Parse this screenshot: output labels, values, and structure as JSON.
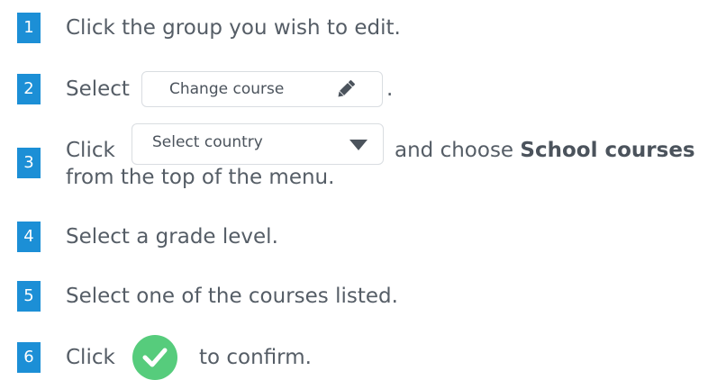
{
  "steps": [
    {
      "number": "1",
      "text": "Click the group you wish to edit."
    },
    {
      "number": "2",
      "prefix": "Select",
      "button_label": "Change course",
      "button_icon": "pencil-icon",
      "suffix": "."
    },
    {
      "number": "3",
      "prefix": "Click",
      "dropdown_label": "Select country",
      "dropdown_icon": "caret-down-icon",
      "middle": "and choose",
      "bold": "School courses",
      "line2": "from the top of the menu."
    },
    {
      "number": "4",
      "text": "Select a grade level."
    },
    {
      "number": "5",
      "text": "Select one of the courses listed."
    },
    {
      "number": "6",
      "prefix": "Click",
      "button_icon": "checkmark-icon",
      "suffix": "to confirm."
    }
  ],
  "colors": {
    "badge": "#1c8fd6",
    "text": "#555d66",
    "confirm": "#56cc7c",
    "icon": "#4b535c"
  }
}
